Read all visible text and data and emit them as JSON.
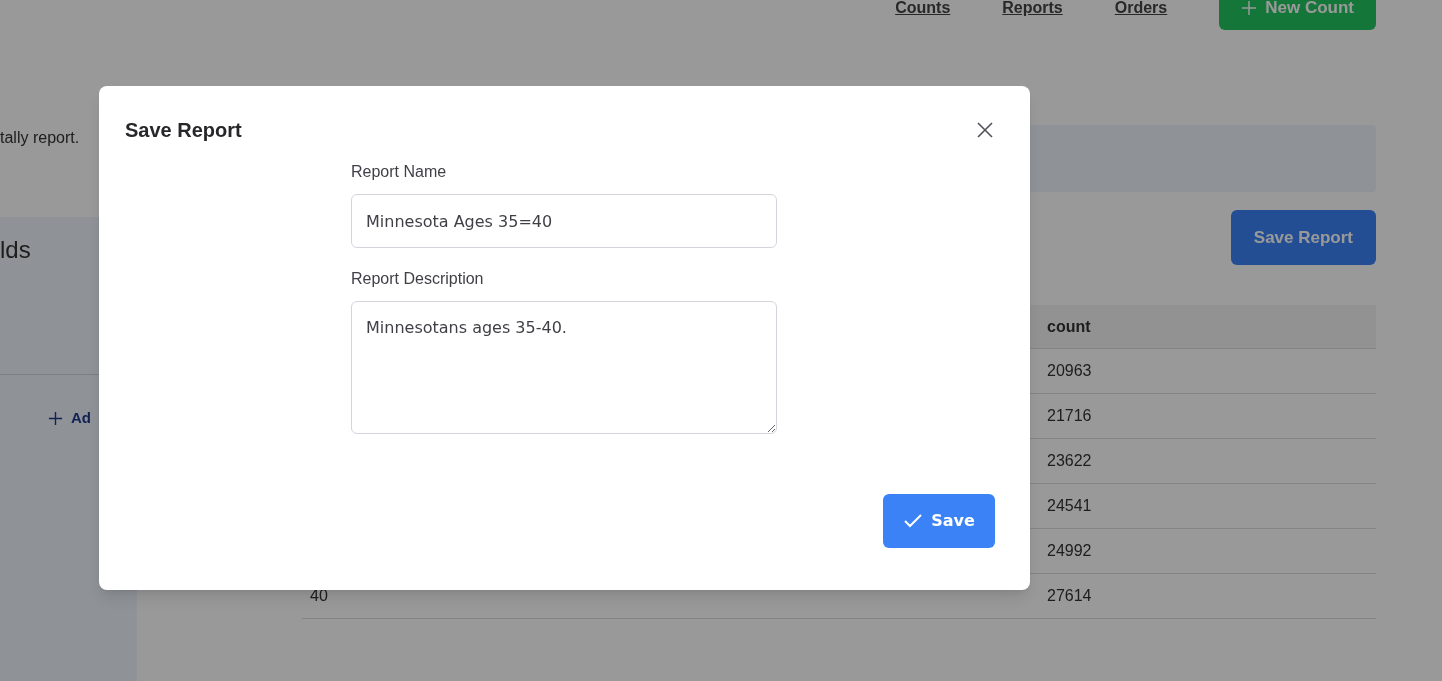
{
  "nav": {
    "links": [
      "Counts",
      "Reports",
      "Orders"
    ],
    "new_button": "New Count"
  },
  "intro_text": "tally report.",
  "sidebar": {
    "heading": "lds",
    "add_label": "Ad"
  },
  "save_report_button": "Save Report",
  "table": {
    "columns": [
      "count"
    ],
    "rows": [
      {
        "count": "20963"
      },
      {
        "count": "21716"
      },
      {
        "count": "23622"
      },
      {
        "count": "24541"
      },
      {
        "count": "24992"
      },
      {
        "column_1": "40",
        "count": "27614"
      }
    ]
  },
  "dialog": {
    "title": "Save Report",
    "fields": [
      {
        "label": "Report Name",
        "kind": "input",
        "value": "Minnesota Ages 35=40"
      },
      {
        "label": "Report Description",
        "kind": "textarea",
        "value": "Minnesotans ages 35-40."
      }
    ],
    "submit": "Save"
  }
}
